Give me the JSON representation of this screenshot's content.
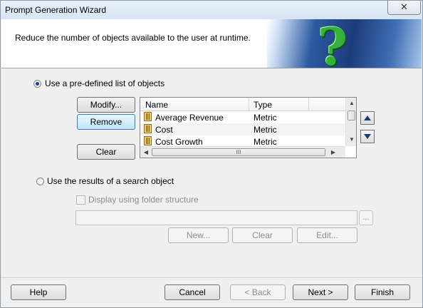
{
  "window": {
    "title": "Prompt Generation Wizard",
    "close_glyph": "✕"
  },
  "header": {
    "description": "Reduce the number of objects available to the user at runtime.",
    "icon": "question-mark-icon",
    "icon_glyph": "?"
  },
  "predefined": {
    "radio_label": "Use a pre-defined list of objects",
    "modify_label": "Modify...",
    "remove_label": "Remove",
    "clear_label": "Clear",
    "columns": [
      "Name",
      "Type"
    ],
    "rows": [
      {
        "name": "Average Revenue",
        "type": "Metric"
      },
      {
        "name": "Cost",
        "type": "Metric"
      },
      {
        "name": "Cost Growth",
        "type": "Metric"
      }
    ],
    "hscroll_grip": "III"
  },
  "search": {
    "radio_label": "Use the results of a search object",
    "checkbox_label": "Display using folder structure",
    "field_value": "",
    "ellipsis_label": "...",
    "new_label": "New...",
    "clear_label": "Clear",
    "edit_label": "Edit..."
  },
  "footer": {
    "help_label": "Help",
    "cancel_label": "Cancel",
    "back_label": "< Back",
    "next_label": "Next >",
    "finish_label": "Finish"
  }
}
